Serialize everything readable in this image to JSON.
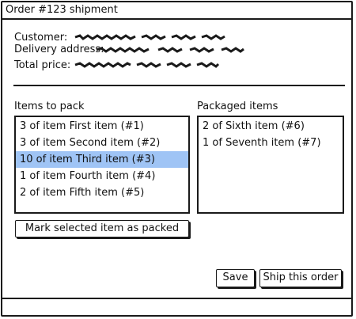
{
  "window": {
    "title": "Order #123 shipment"
  },
  "order_info": {
    "customer_label": "Customer:",
    "delivery_label": "Delivery address:",
    "total_label": "Total price:"
  },
  "items_to_pack": {
    "label": "Items to pack",
    "items": [
      "3 of item First item (#1)",
      "3 of item Second item (#2)",
      "10 of item Third item (#3)",
      "1 of item Fourth item (#4)",
      "2 of item Fifth item (#5)"
    ],
    "selected_index": 2
  },
  "packaged_items": {
    "label": "Packaged items",
    "items": [
      "2 of Sixth item (#6)",
      "1 of Seventh item (#7)"
    ]
  },
  "buttons": {
    "mark_packed": "Mark selected item as packed",
    "save": "Save",
    "ship": "Ship this order"
  },
  "colors": {
    "selection": "#9fc4f5",
    "border": "#1a1a1a"
  }
}
